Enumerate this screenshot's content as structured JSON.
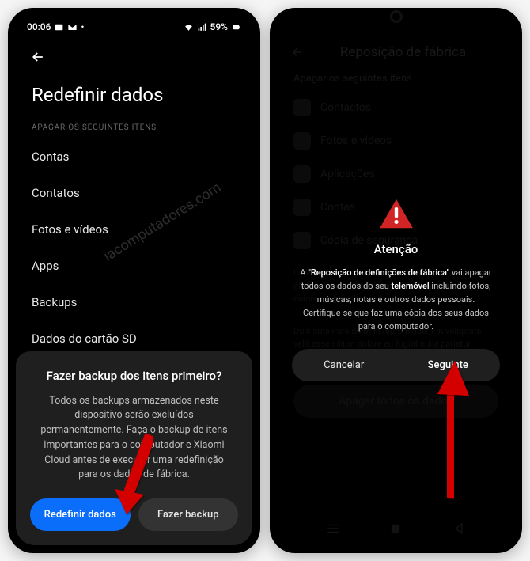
{
  "phone1": {
    "status": {
      "time": "00:06",
      "battery": "59%"
    },
    "title": "Redefinir dados",
    "section_header": "APAGAR OS SEGUINTES ITENS",
    "items": [
      "Contas",
      "Contatos",
      "Fotos e vídeos",
      "Apps",
      "Backups",
      "Dados do cartão SD"
    ],
    "sheet": {
      "title": "Fazer backup dos itens primeiro?",
      "body": "Todos os backups armazenados neste dispositivo serão excluídos permanentemente. Faça o backup de itens importantes para o computador e Xiaomi Cloud antes de executar uma redefinição para os dados de fábrica.",
      "primary": "Redefinir dados",
      "secondary": "Fazer backup"
    },
    "watermark": "iacomputadores.com"
  },
  "phone2": {
    "bg": {
      "title": "Reposição de fábrica",
      "section": "Apagar os seguintes itens",
      "items": [
        "Contactos",
        "Fotos e vídeos",
        "Aplicações",
        "Contas",
        "Cópia de segurança"
      ],
      "bottom_btn": "Apagar todos os dados"
    },
    "dialog": {
      "title": "Atenção",
      "body_prefix": "A ",
      "body_bold1": "\"Reposição de definições de fábrica\"",
      "body_mid": " vai apagar todos os dados do seu ",
      "body_bold2": "telemóvel",
      "body_suffix": " incluindo fotos, músicas, notas e outros dados pessoais. Certifique-se que faz uma cópia dos seus dados para o computador.",
      "cancel": "Cancelar",
      "next": "Seguinte"
    }
  }
}
